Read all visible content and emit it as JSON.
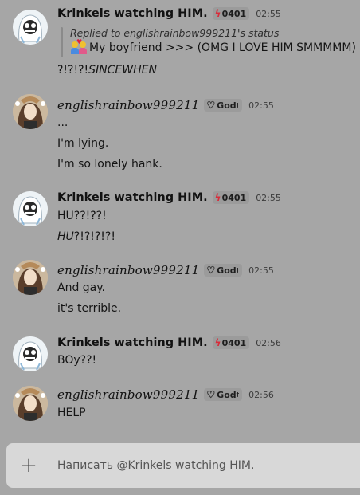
{
  "users": {
    "krinkels": {
      "name": "Krinkels watching HIM.",
      "tag": "0401"
    },
    "english": {
      "name": "englishrainbow999211",
      "tag": "God",
      "tag_sup": "†"
    }
  },
  "messages": [
    {
      "author": "krinkels",
      "time": "02:55",
      "reply": {
        "label": "Replied to englishrainbow999211's status",
        "content": "My boyfriend >>> (OMG I LOVE HIM SMMMMM)"
      },
      "lines": [
        {
          "plain": "?!?!?!",
          "italic": "SINCEWHEN"
        }
      ]
    },
    {
      "author": "english",
      "time": "02:55",
      "lines": [
        "...",
        "I'm lying.",
        "I'm so lonely hank."
      ]
    },
    {
      "author": "krinkels",
      "time": "02:55",
      "lines": [
        "HU??!??!",
        {
          "italic": "HU",
          "plain": "?!?!?!?!"
        }
      ]
    },
    {
      "author": "english",
      "time": "02:55",
      "lines": [
        "And gay.",
        "it's terrible."
      ]
    },
    {
      "author": "krinkels",
      "time": "02:56",
      "lines": [
        "BOy??!"
      ]
    },
    {
      "author": "english",
      "time": "02:56",
      "lines": [
        "HELP"
      ]
    }
  ],
  "composer": {
    "placeholder": "Написать @Krinkels watching HIM."
  },
  "icons": {
    "krinkels_tag": "lightning-bolt-icon",
    "english_tag": "heart-icon",
    "composer": "plus-icon"
  },
  "colors": {
    "background": "#a6a6a6",
    "composer": "#d8d8d8",
    "bolt": "#d92b3a"
  }
}
